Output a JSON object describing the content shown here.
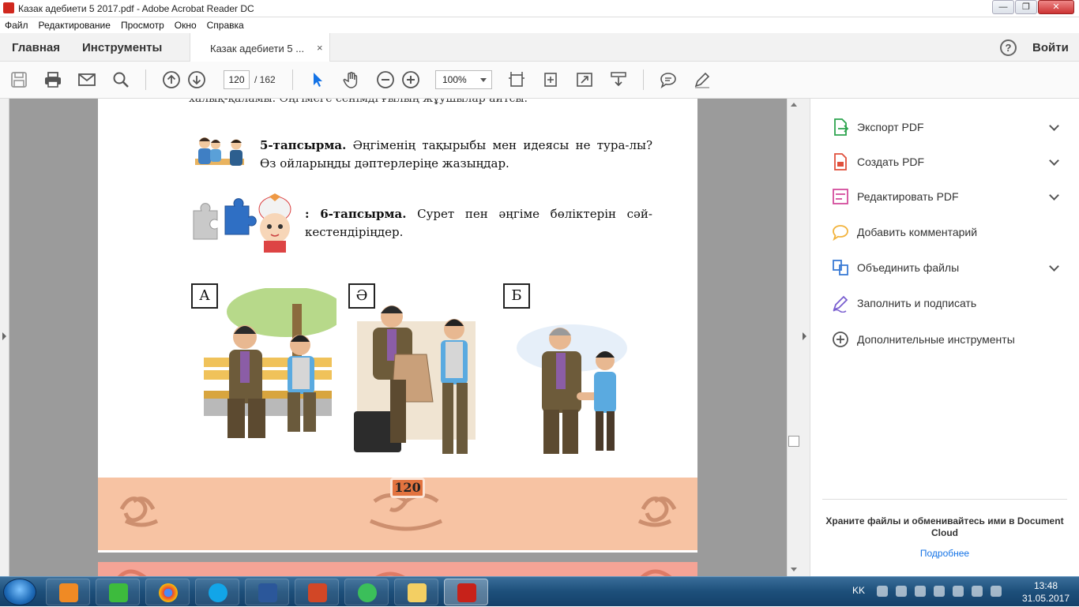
{
  "window": {
    "title": "Казак адебиети  5  2017.pdf - Adobe Acrobat Reader DC",
    "minimize": "—",
    "maximize": "❐",
    "close": "✕"
  },
  "menu": [
    "Файл",
    "Редактирование",
    "Просмотр",
    "Окно",
    "Справка"
  ],
  "tabs": {
    "home": "Главная",
    "tools": "Инструменты",
    "document": "Казак адебиети  5 ...",
    "close": "×",
    "help": "?",
    "signin": "Войти"
  },
  "toolbar": {
    "page_current": "120",
    "page_total": "/ 162",
    "zoom": "100%"
  },
  "document": {
    "cut_top_text": "халық-қаламы. Әңгімеге сенімді ғылың жұушылар айтсы.",
    "task5_title": "5-тапсырма.",
    "task5_text": "Әңгіменің тақырыбы мен идеясы не тура-лы? Өз ойларыңды дәптерлеріңе жазыңдар.",
    "task6_prefix": ":",
    "task6_title": "6-тапсырма.",
    "task6_text": "Сурет пен әңгіме бөліктерін сәй-кестендіріңдер.",
    "label_a": "А",
    "label_ae": "Ә",
    "label_b": "Б",
    "page_number": "120"
  },
  "right_panel": {
    "items": [
      {
        "label": "Экспорт PDF",
        "icon": "export-pdf-icon",
        "color": "#2da44e"
      },
      {
        "label": "Создать PDF",
        "icon": "create-pdf-icon",
        "color": "#e0503c"
      },
      {
        "label": "Редактировать PDF",
        "icon": "edit-pdf-icon",
        "color": "#d44c9c"
      },
      {
        "label": "Добавить комментарий",
        "icon": "comment-icon",
        "color": "#f2b33d"
      },
      {
        "label": "Объединить файлы",
        "icon": "combine-files-icon",
        "color": "#3a7bd5"
      },
      {
        "label": "Заполнить и подписать",
        "icon": "fill-sign-icon",
        "color": "#7a5fd0"
      },
      {
        "label": "Дополнительные инструменты",
        "icon": "more-tools-icon",
        "color": "#555555"
      }
    ],
    "cloud_text": "Храните файлы и обменивайтесь ими в Document Cloud",
    "cloud_link": "Подробнее"
  },
  "taskbar": {
    "lang": "KK",
    "time": "13:48",
    "date": "31.05.2017"
  }
}
